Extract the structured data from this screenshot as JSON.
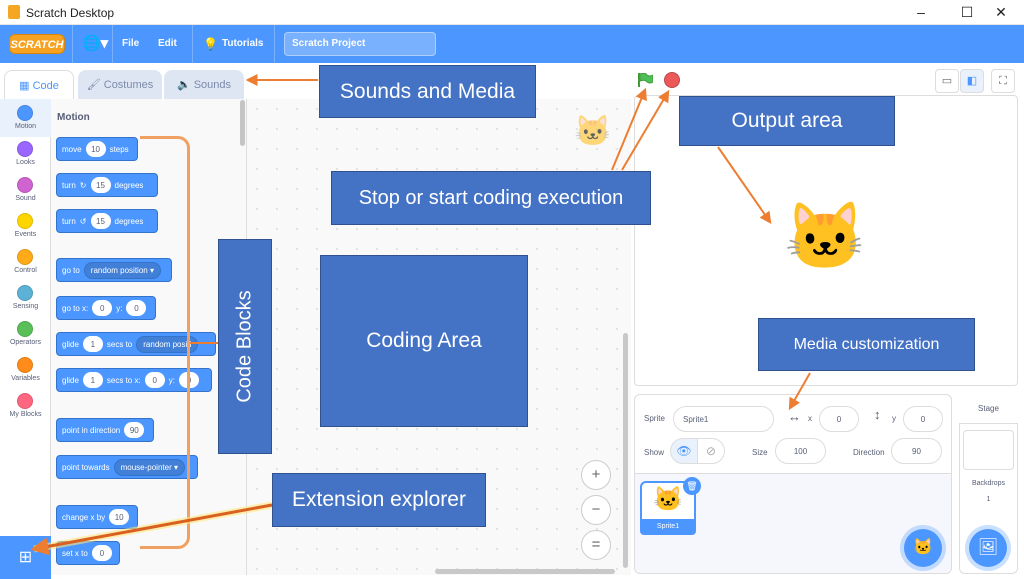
{
  "window": {
    "title": "Scratch Desktop",
    "minimize": "–",
    "maximize": "☐",
    "close": "✕"
  },
  "menubar": {
    "logo": "SCRATCH",
    "language_icon": "globe-icon",
    "file": "File",
    "edit": "Edit",
    "tutorials": "Tutorials",
    "project_title": "Scratch Project"
  },
  "tabs": {
    "code": "Code",
    "costumes": "Costumes",
    "sounds": "Sounds"
  },
  "categories": [
    {
      "label": "Motion",
      "color": "#4c97ff"
    },
    {
      "label": "Looks",
      "color": "#9966ff"
    },
    {
      "label": "Sound",
      "color": "#cf63cf"
    },
    {
      "label": "Events",
      "color": "#ffd500"
    },
    {
      "label": "Control",
      "color": "#ffab19"
    },
    {
      "label": "Sensing",
      "color": "#5cb1d6"
    },
    {
      "label": "Operators",
      "color": "#59c059"
    },
    {
      "label": "Variables",
      "color": "#ff8c1a"
    },
    {
      "label": "My Blocks",
      "color": "#ff6680"
    }
  ],
  "palette": {
    "heading": "Motion",
    "blocks": {
      "move": {
        "pre": "move",
        "val": "10",
        "post": "steps"
      },
      "turn_right": {
        "pre": "turn",
        "icon": "↻",
        "val": "15",
        "post": "degrees"
      },
      "turn_left": {
        "pre": "turn",
        "icon": "↺",
        "val": "15",
        "post": "degrees"
      },
      "go_to": {
        "pre": "go to",
        "dd": "random position ▾"
      },
      "go_to_xy": {
        "pre": "go to x:",
        "x": "0",
        "ymid": "y:",
        "y": "0"
      },
      "glide_to": {
        "pre": "glide",
        "val": "1",
        "mid": "secs to",
        "dd": "random positi"
      },
      "glide_xy": {
        "pre": "glide",
        "val": "1",
        "mid": "secs to x:",
        "x": "0",
        "ymid": "y:",
        "y": "0"
      },
      "point_dir": {
        "pre": "point in direction",
        "val": "90"
      },
      "point_towards": {
        "pre": "point towards",
        "dd": "mouse-pointer ▾"
      },
      "change_x": {
        "pre": "change x by",
        "val": "10"
      },
      "set_x": {
        "pre": "set x to",
        "val": "0"
      }
    }
  },
  "zoom": {
    "in": "+",
    "out": "−",
    "reset": "="
  },
  "sprite_info": {
    "sprite_label": "Sprite",
    "sprite_name": "Sprite1",
    "x_label": "x",
    "x_value": "0",
    "y_label": "y",
    "y_value": "0",
    "show_label": "Show",
    "size_label": "Size",
    "size_value": "100",
    "direction_label": "Direction",
    "direction_value": "90"
  },
  "sprite_list": {
    "thumb_label": "Sprite1"
  },
  "stage_pane": {
    "heading": "Stage",
    "backdrops_label": "Backdrops",
    "backdrops_count": "1"
  },
  "annotations": {
    "sounds_media": "Sounds and Media",
    "output_area": "Output area",
    "stop_start": "Stop or start coding execution",
    "code_blocks": "Code Blocks",
    "coding_area": "Coding Area",
    "media_custom": "Media customization",
    "extension_explorer": "Extension explorer"
  },
  "colors": {
    "accent": "#4c97ff",
    "annotation": "#4472c4",
    "arrow": "#ed7d31"
  }
}
